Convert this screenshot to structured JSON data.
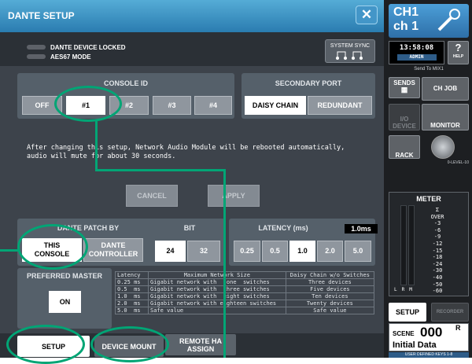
{
  "window": {
    "title": "DANTE SETUP",
    "close_icon": "close-icon"
  },
  "status": {
    "locked_label": "DANTE DEVICE LOCKED",
    "aes67_label": "AES67 MODE",
    "system_sync_label": "SYSTEM SYNC"
  },
  "console_id": {
    "title": "CONSOLE ID",
    "options": [
      "OFF",
      "#1",
      "#2",
      "#3",
      "#4"
    ],
    "selected": "#1"
  },
  "secondary_port": {
    "title": "SECONDARY PORT",
    "options": [
      "DAISY CHAIN",
      "REDUNDANT"
    ],
    "selected": "DAISY CHAIN"
  },
  "notice": "After changing this setup, Network Audio Module will be rebooted automatically,\naudio will mute for about 30 seconds.",
  "actions": {
    "cancel": "CANCEL",
    "apply": "APPLY"
  },
  "patch_by": {
    "title": "DANTE PATCH BY",
    "this_console": "THIS\nCONSOLE",
    "dante_controller": "DANTE\nCONTROLLER",
    "selected": "THIS CONSOLE"
  },
  "bit": {
    "title": "BIT",
    "options": [
      "24",
      "32"
    ],
    "selected": "24"
  },
  "latency": {
    "title": "LATENCY (ms)",
    "current": "1.0ms",
    "options": [
      "0.25",
      "0.5",
      "1.0",
      "2.0",
      "5.0"
    ],
    "selected": "1.0"
  },
  "preferred_master": {
    "title": "PREFERRED MASTER",
    "button": "ON"
  },
  "latency_table": {
    "headers": [
      "Latency",
      "Maximum Network Size",
      "Daisy Chain w/o Switches"
    ],
    "rows": [
      [
        "0.25 ms",
        "Gigabit network with   one  switches",
        "Three devices"
      ],
      [
        "0.5  ms",
        "Gigabit network with  three switches",
        "Five devices"
      ],
      [
        "1.0  ms",
        "Gigabit network with  eight switches",
        "Ten devices"
      ],
      [
        "2.0  ms",
        "Gigabit network with eighteen switches",
        "Twenty devices"
      ],
      [
        "5.0  ms",
        "Safe value",
        "Safe value"
      ]
    ]
  },
  "tabs": [
    {
      "label": "SETUP",
      "active": true
    },
    {
      "label": "DEVICE MOUNT",
      "active": false
    },
    {
      "label": "REMOTE HA\nASSIGN",
      "active": false
    }
  ],
  "side": {
    "channel_line1": "CH1",
    "channel_line2": "ch 1",
    "time": "13:58:08",
    "user": "ADMIN",
    "help": "HELP",
    "send_to": "Send To MIX1",
    "sends": "SENDS",
    "ch_job": "CH JOB",
    "io_device": "I/O\nDEVICE",
    "monitor": "MONITOR",
    "rack": "RACK",
    "level": "0-LEVEL-10",
    "meter_title": "METER",
    "meter_scale": [
      "Σ",
      "OVER",
      "-3",
      "-6",
      "-9",
      "-12",
      "-15",
      "-18",
      "-24",
      "-30",
      "-40",
      "-50",
      "-60"
    ],
    "meter_channels": [
      "L",
      "R",
      "M"
    ],
    "setup": "SETUP",
    "recorder": "RECORDER",
    "scene_label": "SCENE",
    "scene_number": "000",
    "scene_suffix": "R",
    "scene_name": "Initial Data",
    "user_keys": "USER DEFINED KEYS 1-8"
  },
  "colors": {
    "highlight": "#00a575",
    "title_bar": "#3a8fc4",
    "panel": "#55606a"
  }
}
